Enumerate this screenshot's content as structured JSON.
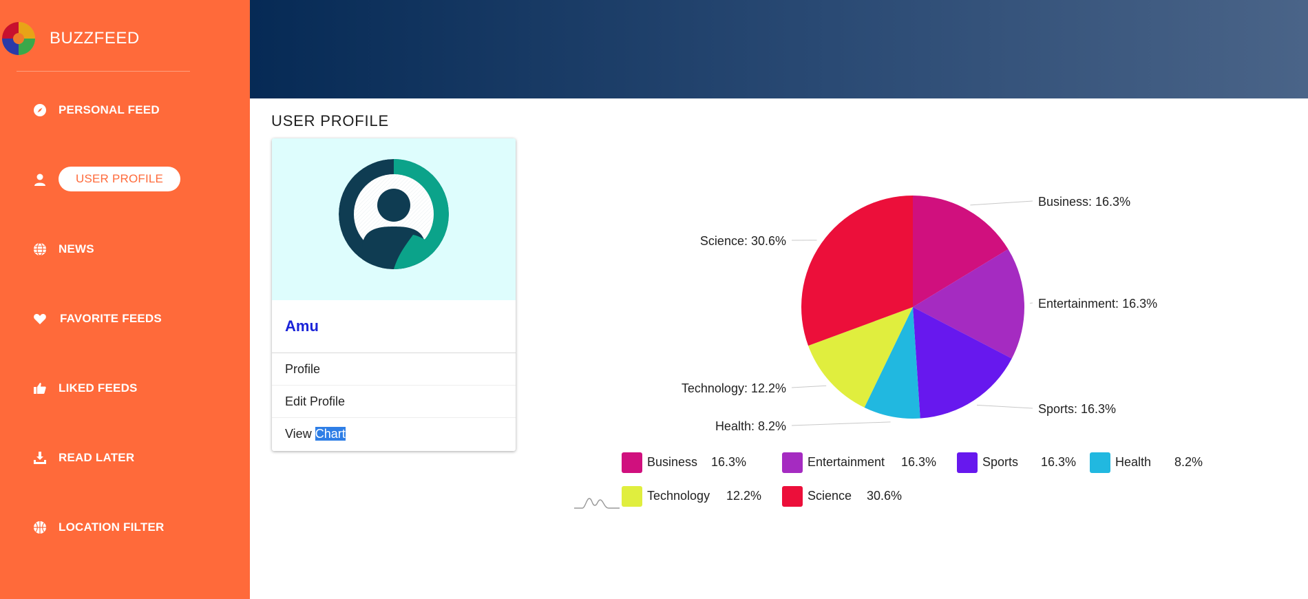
{
  "brand": {
    "name": "BUZZFEED",
    "logo_icon": "pinwheel-logo"
  },
  "sidebar": {
    "items": [
      {
        "label": "PERSONAL FEED",
        "icon": "compass-icon",
        "active": false
      },
      {
        "label": "USER PROFILE",
        "icon": "user-icon",
        "active": true
      },
      {
        "label": "NEWS",
        "icon": "globe-icon",
        "active": false
      },
      {
        "label": "FAVORITE FEEDS",
        "icon": "heart-icon",
        "active": false
      },
      {
        "label": "LIKED FEEDS",
        "icon": "thumbs-up-icon",
        "active": false
      },
      {
        "label": "READ LATER",
        "icon": "download-icon",
        "active": false
      },
      {
        "label": "LOCATION FILTER",
        "icon": "basketball-icon",
        "active": false
      }
    ]
  },
  "page": {
    "title": "USER PROFILE"
  },
  "card": {
    "name": "Amu",
    "menu": [
      {
        "label": "Profile"
      },
      {
        "label": "Edit Profile"
      },
      {
        "label_plain": "View ",
        "label_selected": "Chart"
      }
    ]
  },
  "colors": {
    "sidebar_bg": "#ff6a3a",
    "header_gradient": [
      "#062a55",
      "#4a6488"
    ],
    "name_color": "#1a23d8",
    "card_media_bg": "#defdfd"
  },
  "chart_data": {
    "type": "pie",
    "slices": [
      {
        "label": "Business",
        "value": 16.3,
        "color": "#d0107e",
        "callout": "Business: 16.3%",
        "legend_value": "16.3%"
      },
      {
        "label": "Entertainment",
        "value": 16.3,
        "color": "#a52bc1",
        "callout": "Entertainment: 16.3%",
        "legend_value": "16.3%"
      },
      {
        "label": "Sports",
        "value": 16.3,
        "color": "#6718ee",
        "callout": "Sports: 16.3%",
        "legend_value": "16.3%"
      },
      {
        "label": "Health",
        "value": 8.2,
        "color": "#21b8e0",
        "callout": "Health: 8.2%",
        "legend_value": "8.2%"
      },
      {
        "label": "Technology",
        "value": 12.2,
        "color": "#e0ee3e",
        "callout": "Technology: 12.2%",
        "legend_value": "12.2%"
      },
      {
        "label": "Science",
        "value": 30.6,
        "color": "#ec0f3a",
        "callout": "Science: 30.6%",
        "legend_value": "30.6%"
      }
    ],
    "legend_placement": "bottom"
  }
}
